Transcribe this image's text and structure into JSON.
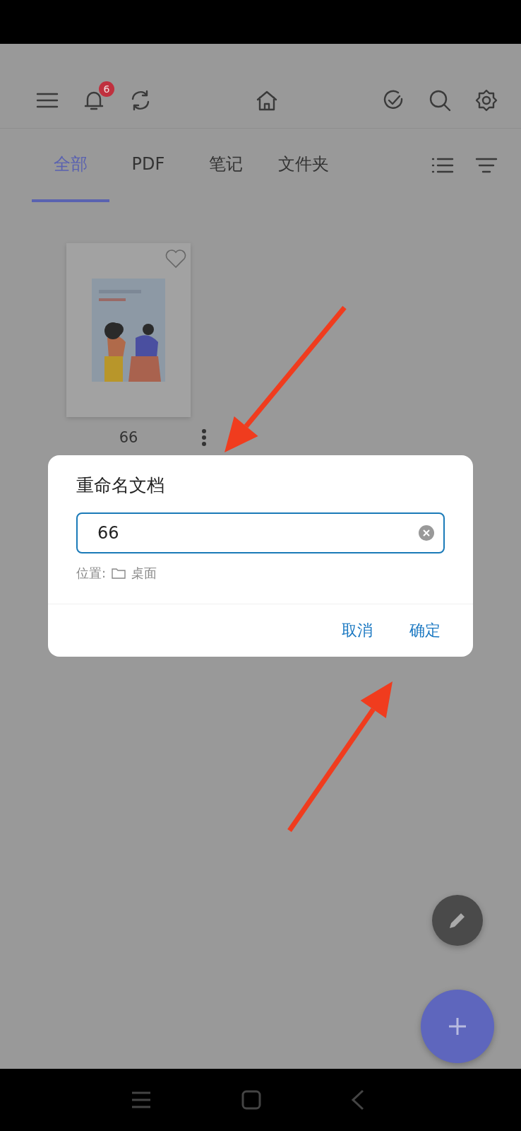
{
  "toolbar": {
    "notification_count": "6"
  },
  "tabs": [
    {
      "label": "全部",
      "selected": true
    },
    {
      "label": "PDF",
      "selected": false
    },
    {
      "label": "笔记",
      "selected": false
    },
    {
      "label": "文件夹",
      "selected": false
    }
  ],
  "documents": [
    {
      "title": "66",
      "favorite": false,
      "kind": "picture"
    }
  ],
  "dialog": {
    "title": "重命名文档",
    "field": {
      "value": "66"
    },
    "location_label": "位置:",
    "location": "桌面",
    "buttons": [
      "取消",
      "确定"
    ]
  }
}
